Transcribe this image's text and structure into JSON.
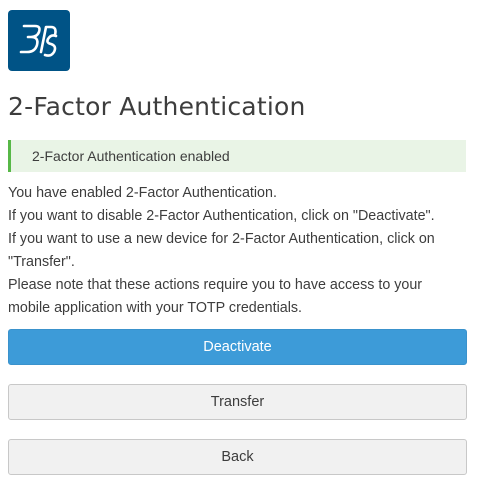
{
  "logo": {
    "label": "3DS"
  },
  "page_title": "2-Factor Authentication",
  "alert": {
    "text": "2-Factor Authentication enabled"
  },
  "description": {
    "line1": "You have enabled 2-Factor Authentication.",
    "line2": "If you want to disable 2-Factor Authentication, click on \"Deactivate\".",
    "line3": "If you want to use a new device for 2-Factor Authentication, click on",
    "line4": "\"Transfer\".",
    "line5": "Please note that these actions require you to have access to your",
    "line6": "mobile application with your TOTP credentials."
  },
  "buttons": {
    "deactivate": "Deactivate",
    "transfer": "Transfer",
    "back": "Back"
  },
  "colors": {
    "brand": "#005386",
    "primary": "#3d9bd8",
    "success_border": "#57b847",
    "success_bg": "#e9f4e6"
  }
}
